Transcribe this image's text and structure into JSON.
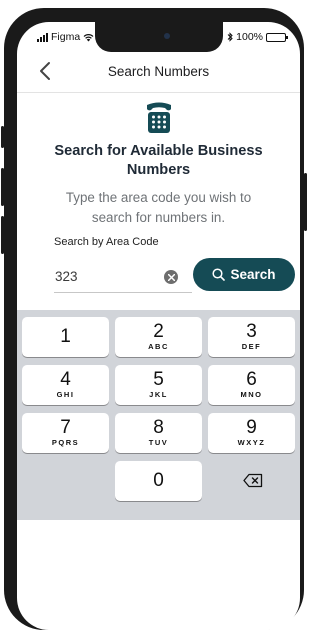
{
  "status_bar": {
    "carrier": "Figma",
    "battery": "100%"
  },
  "nav": {
    "title": "Search Numbers"
  },
  "hero": {
    "headline": "Search for Available Business Numbers",
    "subtext": "Type the area code you wish to search for numbers in."
  },
  "search": {
    "label": "Search by Area Code",
    "value": "323",
    "button_label": "Search"
  },
  "keypad": {
    "keys": [
      {
        "digit": "1",
        "letters": ""
      },
      {
        "digit": "2",
        "letters": "ABC"
      },
      {
        "digit": "3",
        "letters": "DEF"
      },
      {
        "digit": "4",
        "letters": "GHI"
      },
      {
        "digit": "5",
        "letters": "JKL"
      },
      {
        "digit": "6",
        "letters": "MNO"
      },
      {
        "digit": "7",
        "letters": "PQRS"
      },
      {
        "digit": "8",
        "letters": "TUV"
      },
      {
        "digit": "9",
        "letters": "WXYZ"
      },
      {
        "digit": "0",
        "letters": ""
      }
    ]
  },
  "colors": {
    "brand": "#154b55",
    "text_dark": "#1f2a36",
    "text_muted": "#6f7377",
    "keypad_bg": "#d1d4d9"
  },
  "icons": [
    "back-chevron-icon",
    "telephone-icon",
    "clear-icon",
    "search-icon",
    "backspace-icon",
    "wifi-icon",
    "bluetooth-icon",
    "battery-icon",
    "signal-icon"
  ]
}
